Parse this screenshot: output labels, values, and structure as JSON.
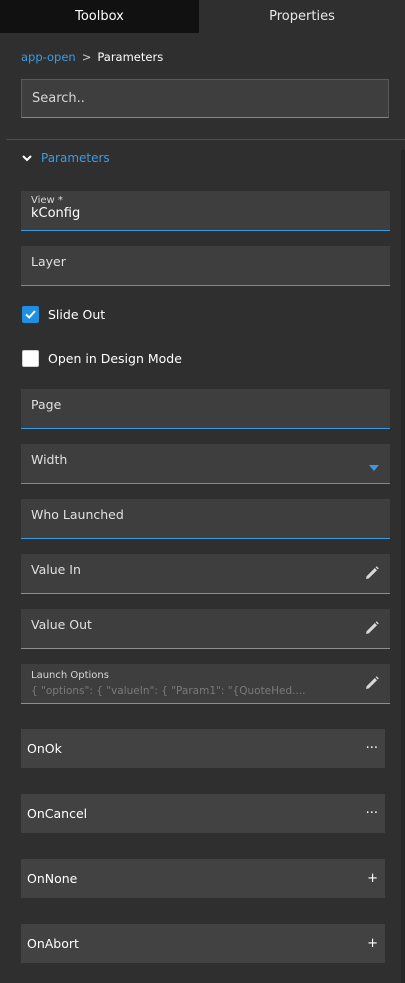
{
  "tabs": {
    "toolbox": "Toolbox",
    "properties": "Properties"
  },
  "breadcrumb": {
    "parent": "app-open",
    "separator": ">",
    "current": "Parameters"
  },
  "search": {
    "placeholder": "Search.."
  },
  "section": {
    "title": "Parameters"
  },
  "fields": {
    "view": {
      "label": "View *",
      "value": "kConfig"
    },
    "layer": {
      "label": "Layer"
    },
    "page": {
      "label": "Page"
    },
    "width": {
      "label": "Width"
    },
    "who_launched": {
      "label": "Who Launched"
    },
    "value_in": {
      "label": "Value In"
    },
    "value_out": {
      "label": "Value Out"
    },
    "launch_options": {
      "label": "Launch Options",
      "value": "{  \"options\": {    \"valueIn\": {      \"Param1\": \"{QuoteHed...."
    }
  },
  "checkboxes": {
    "slide_out": {
      "label": "Slide Out",
      "checked": true
    },
    "design_mode": {
      "label": "Open in Design Mode",
      "checked": false
    }
  },
  "events": [
    {
      "label": "OnOk",
      "action": "···"
    },
    {
      "label": "OnCancel",
      "action": "···"
    },
    {
      "label": "OnNone",
      "action": "+"
    },
    {
      "label": "OnAbort",
      "action": "+"
    }
  ],
  "colors": {
    "accent": "#3c9be0",
    "background": "#2f2f2f",
    "field": "#3e3e3e",
    "event": "#424242"
  },
  "icons": {
    "section_toggle": "chevron-down-icon",
    "edit": "pencil-icon",
    "dropdown": "caret-down-icon",
    "check": "check-icon"
  }
}
